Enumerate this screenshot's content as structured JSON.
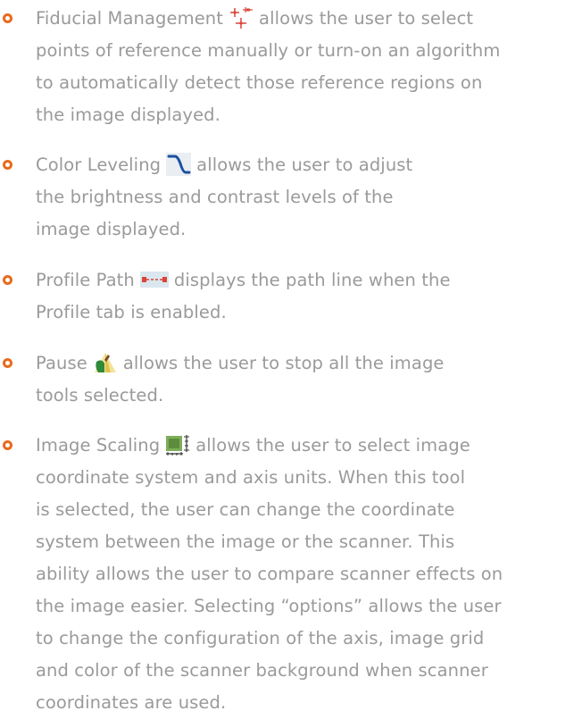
{
  "items": [
    {
      "name": "Fiducial Management",
      "icon": "fiducial-crosshair-icon",
      "lines": [
        "allows the user to select",
        "points of reference manually or turn-on an algorithm",
        "to automatically detect those reference regions on",
        "the image displayed."
      ]
    },
    {
      "name": "Color Leveling",
      "icon": "color-leveling-curve-icon",
      "lines": [
        "allows the user to adjust",
        "the brightness and contrast levels of the",
        "image displayed."
      ]
    },
    {
      "name": "Profile Path",
      "icon": "profile-path-icon",
      "lines": [
        "displays the path line when the",
        "Profile tab is enabled."
      ]
    },
    {
      "name": "Pause",
      "icon": "pause-tools-icon",
      "lines": [
        "allows the user to stop all the image",
        "tools selected."
      ]
    },
    {
      "name": "Image Scaling",
      "icon": "image-scaling-icon",
      "lines": [
        "allows the user to select image",
        "coordinate system and axis units. When this tool",
        "is selected, the user can change the coordinate",
        "system between the image or the scanner. This",
        "ability allows the user to compare scanner effects on",
        "the image easier. Selecting “options” allows the user",
        "to change the configuration of the axis, image grid",
        "and color of the scanner background when scanner",
        "coordinates are used."
      ]
    }
  ],
  "colors": {
    "bullet": "#e96a1c",
    "text": "#9a9a9a"
  }
}
